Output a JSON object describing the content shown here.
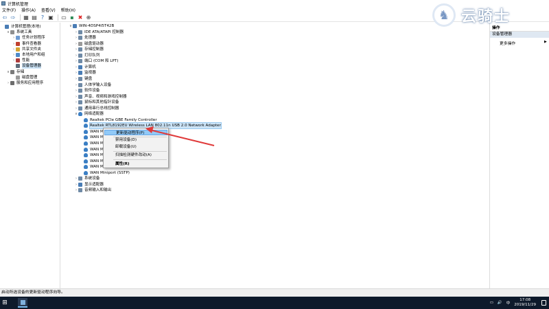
{
  "window": {
    "title": "计算机管理"
  },
  "menu": [
    "文件(F)",
    "操作(A)",
    "查看(V)",
    "帮助(H)"
  ],
  "toolbar_icons": [
    "back-icon",
    "forward-icon",
    "up-icon",
    "show-tree-icon",
    "properties-icon",
    "help-icon",
    "console-icon",
    "scan-icon",
    "uninstall-icon",
    "update-icon"
  ],
  "left_tree": [
    {
      "label": "计算机管理(本地)",
      "depth": 0,
      "twisty": "",
      "icon": "comp"
    },
    {
      "label": "系统工具",
      "depth": 1,
      "twisty": "∨",
      "icon": "tool"
    },
    {
      "label": "任务计划程序",
      "depth": 2,
      "twisty": "›",
      "icon": "task"
    },
    {
      "label": "事件查看器",
      "depth": 2,
      "twisty": "›",
      "icon": "evt"
    },
    {
      "label": "共享文件夹",
      "depth": 2,
      "twisty": "›",
      "icon": "share"
    },
    {
      "label": "本地用户和组",
      "depth": 2,
      "twisty": "›",
      "icon": "grp"
    },
    {
      "label": "性能",
      "depth": 2,
      "twisty": "›",
      "icon": "perf"
    },
    {
      "label": "设备管理器",
      "depth": 2,
      "twisty": "",
      "icon": "dev",
      "selected": true
    },
    {
      "label": "存储",
      "depth": 1,
      "twisty": "∨",
      "icon": "store"
    },
    {
      "label": "磁盘管理",
      "depth": 2,
      "twisty": "",
      "icon": "disk"
    },
    {
      "label": "服务和应用程序",
      "depth": 1,
      "twisty": "›",
      "icon": "svc"
    }
  ],
  "device_tree": [
    {
      "label": "WIN-4DSP4I5T42B",
      "depth": 0,
      "twisty": "∨",
      "icon": "comp"
    },
    {
      "label": "IDE ATA/ATAPI 控制器",
      "depth": 1,
      "twisty": "›",
      "icon": "gen"
    },
    {
      "label": "处理器",
      "depth": 1,
      "twisty": "›",
      "icon": "gen"
    },
    {
      "label": "磁盘驱动器",
      "depth": 1,
      "twisty": "›",
      "icon": "disk"
    },
    {
      "label": "存储控制器",
      "depth": 1,
      "twisty": "›",
      "icon": "gen"
    },
    {
      "label": "打印队列",
      "depth": 1,
      "twisty": "›",
      "icon": "gen"
    },
    {
      "label": "端口 (COM 和 LPT)",
      "depth": 1,
      "twisty": "›",
      "icon": "gen"
    },
    {
      "label": "计算机",
      "depth": 1,
      "twisty": "›",
      "icon": "comp"
    },
    {
      "label": "监视器",
      "depth": 1,
      "twisty": "›",
      "icon": "comp"
    },
    {
      "label": "键盘",
      "depth": 1,
      "twisty": "›",
      "icon": "gen"
    },
    {
      "label": "人体学输入设备",
      "depth": 1,
      "twisty": "›",
      "icon": "gen"
    },
    {
      "label": "软件设备",
      "depth": 1,
      "twisty": "›",
      "icon": "gen"
    },
    {
      "label": "声音、视频和游戏控制器",
      "depth": 1,
      "twisty": "›",
      "icon": "gen"
    },
    {
      "label": "鼠标和其他指针设备",
      "depth": 1,
      "twisty": "›",
      "icon": "gen"
    },
    {
      "label": "通用串行总线控制器",
      "depth": 1,
      "twisty": "›",
      "icon": "gen"
    },
    {
      "label": "网络适配器",
      "depth": 1,
      "twisty": "∨",
      "icon": "net"
    },
    {
      "label": "Realtek PCIe GBE Family Controller",
      "depth": 2,
      "twisty": "",
      "icon": "net"
    },
    {
      "label": "Realtek RTL8192EU Wireless LAN 802.11n USB 2.0 Network Adapter",
      "depth": 2,
      "twisty": "",
      "icon": "net",
      "highlighted": true
    },
    {
      "label": "WAN Miniport (IKEv2)",
      "depth": 2,
      "twisty": "",
      "icon": "net"
    },
    {
      "label": "WAN Miniport (IP)",
      "depth": 2,
      "twisty": "",
      "icon": "net"
    },
    {
      "label": "WAN Miniport (IPv6)",
      "depth": 2,
      "twisty": "",
      "icon": "net"
    },
    {
      "label": "WAN Miniport (L2TP)",
      "depth": 2,
      "twisty": "",
      "icon": "net"
    },
    {
      "label": "WAN Miniport (Network Monitor)",
      "depth": 2,
      "twisty": "",
      "icon": "net"
    },
    {
      "label": "WAN Miniport (PPPOE)",
      "depth": 2,
      "twisty": "",
      "icon": "net"
    },
    {
      "label": "WAN Miniport (PPTP)",
      "depth": 2,
      "twisty": "",
      "icon": "net"
    },
    {
      "label": "WAN Miniport (SSTP)",
      "depth": 2,
      "twisty": "",
      "icon": "net"
    },
    {
      "label": "系统设备",
      "depth": 1,
      "twisty": "›",
      "icon": "gen"
    },
    {
      "label": "显示适配器",
      "depth": 1,
      "twisty": "›",
      "icon": "comp"
    },
    {
      "label": "音频输入和输出",
      "depth": 1,
      "twisty": "›",
      "icon": "gen"
    }
  ],
  "context_menu": {
    "items": [
      "更新驱动程序(P)",
      "禁用设备(D)",
      "卸载设备(U)",
      "扫描检测硬件改动(A)",
      "属性(R)"
    ],
    "active_index": 0
  },
  "actions_pane": {
    "header": "操作",
    "section": "设备管理器",
    "item": "更多操作",
    "arrow": "▶"
  },
  "status_text": "启动所选设备的更新驱动程序向导。",
  "taskbar": {
    "time": "17:08",
    "date": "2019/11/29",
    "ime": "中",
    "volume_icon": "🔊"
  },
  "watermark": {
    "text": "云骑士"
  },
  "colors": {
    "selection": "#cce4f7",
    "menu_active": "#91c9f7",
    "arrow": "#e03a3a",
    "taskbar": "#0e1a2b"
  }
}
